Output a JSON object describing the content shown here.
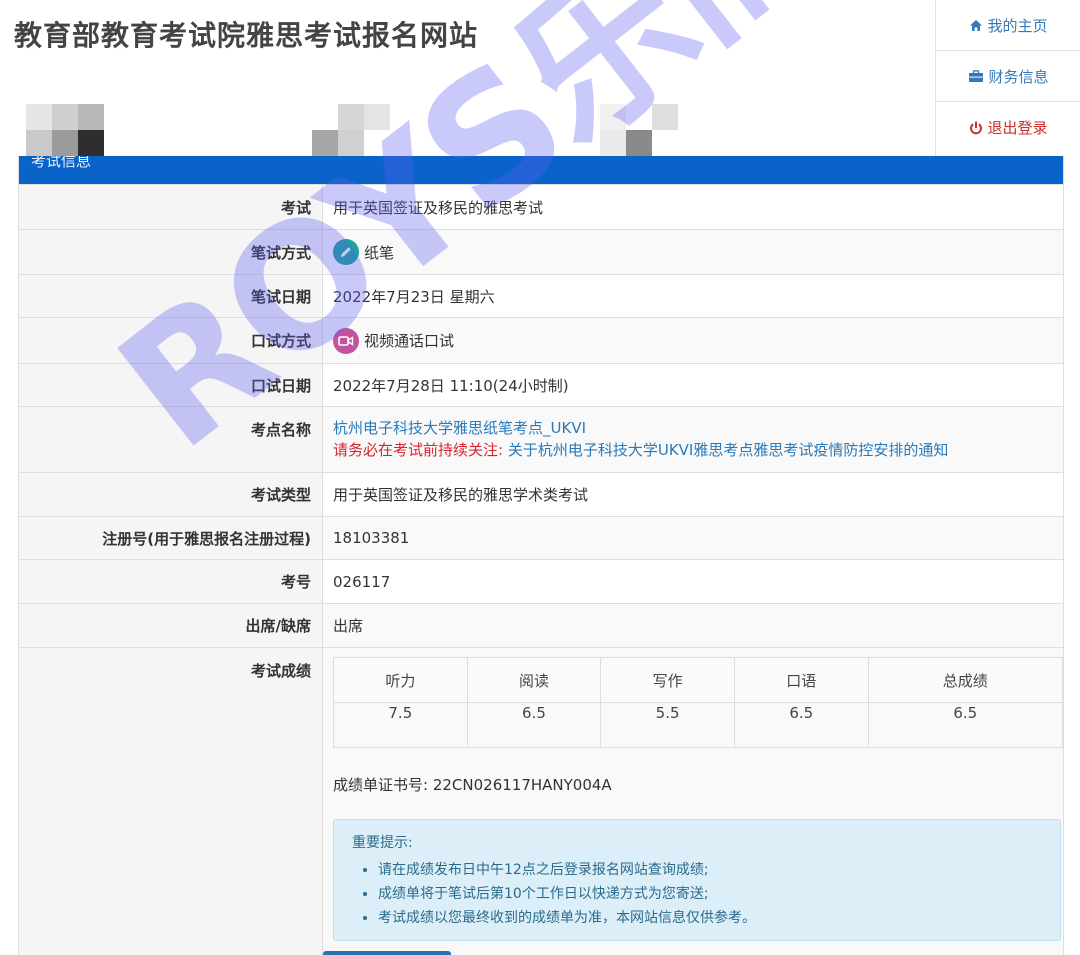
{
  "header": {
    "title": "教育部教育考试院雅思考试报名网站",
    "nav": [
      {
        "label": "我的主页",
        "icon": "home-icon"
      },
      {
        "label": "财务信息",
        "icon": "briefcase-icon"
      },
      {
        "label": "退出登录",
        "icon": "power-icon"
      }
    ]
  },
  "panel": {
    "heading": "考试信息"
  },
  "rows": {
    "exam": {
      "label": "考试",
      "value": "用于英国签证及移民的雅思考试"
    },
    "written_mode": {
      "label": "笔试方式",
      "value": "纸笔",
      "icon": "pencil-icon",
      "icon_color": "#1fa39a"
    },
    "written_date": {
      "label": "笔试日期",
      "value": "2022年7月23日 星期六"
    },
    "speaking_mode": {
      "label": "口试方式",
      "value": "视频通话口试",
      "icon": "video-camera-icon",
      "icon_color": "#c2539d"
    },
    "speaking_date": {
      "label": "口试日期",
      "value": "2022年7月28日 11:10(24小时制)"
    },
    "venue": {
      "label": "考点名称",
      "value": "杭州电子科技大学雅思纸笔考点_UKVI",
      "notice_prefix": "请务必在考试前持续关注:",
      "notice_link": "关于杭州电子科技大学UKVI雅思考点雅思考试疫情防控安排的通知"
    },
    "exam_type": {
      "label": "考试类型",
      "value": "用于英国签证及移民的雅思学术类考试"
    },
    "registration": {
      "label": "注册号(用于雅思报名注册过程)",
      "value": "18103381"
    },
    "candidate_no": {
      "label": "考号",
      "value": "026117"
    },
    "attendance": {
      "label": "出席/缺席",
      "value": "出席"
    },
    "results": {
      "label": "考试成绩"
    }
  },
  "scores": {
    "headers": [
      "听力",
      "阅读",
      "写作",
      "口语",
      "总成绩"
    ],
    "values": [
      "7.5",
      "6.5",
      "5.5",
      "6.5",
      "6.5"
    ]
  },
  "certificate": "成绩单证书号: 22CN026117HANY004A",
  "notice": {
    "title": "重要提示:",
    "items": [
      "请在成绩发布日中午12点之后登录报名网站查询成绩;",
      "成绩单将于笔试后第10个工作日以快递方式为您寄送;",
      "考试成绩以您最终收到的成绩单为准，本网站信息仅供参考。"
    ]
  },
  "watermark": "ROYS乐而思",
  "colors": {
    "header_bar": "#0a63c9",
    "link": "#2a7ab8",
    "warning": "#d9232e",
    "notice_bg": "#dceff8"
  }
}
